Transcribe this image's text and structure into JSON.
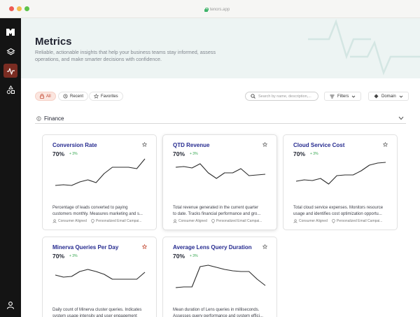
{
  "browser": {
    "url": "tenors.app"
  },
  "header": {
    "title": "Metrics",
    "subtitle_line1": "Reliable, actionable insights that help your business teams stay informed, assess",
    "subtitle_line2": "operations, and make smarter decisions with confidence."
  },
  "filters": {
    "all_label": "All",
    "recent_label": "Recent",
    "favorites_label": "Favorites",
    "search_placeholder": "Search by name, description,...",
    "filters_label": "Filters",
    "domain_label": "Domain"
  },
  "section": {
    "title": "Finance"
  },
  "colors": {
    "accent": "#c2462f",
    "title_blue": "#252a8f",
    "positive": "#2fa34a",
    "sidebar_active": "#7a2c22"
  },
  "cards": [
    {
      "title": "Conversion Rate",
      "value": "70%",
      "delta": "+ 3%",
      "starred": false,
      "desc_line1": "Percentage of leads converted to paying",
      "desc_line2": "customers monthly. Measures marketing and s...",
      "tag1": "Consumer Aligned",
      "tag2": "Personalized Email Campai...",
      "trend": [
        2,
        3,
        2,
        7,
        10,
        6,
        19,
        28,
        28,
        28,
        26,
        40
      ]
    },
    {
      "title": "QTD Revenue",
      "value": "70%",
      "delta": "+ 3%",
      "starred": false,
      "desc_line1": "Total revenue generated in the current quarter",
      "desc_line2": "to date. Tracks financial performance and gro...",
      "tag1": "Consumer Aligned",
      "tag2": "Personalized Email Campai...",
      "trend": [
        28,
        29,
        27,
        33,
        20,
        12,
        20,
        20,
        26,
        16,
        17,
        18
      ]
    },
    {
      "title": "Cloud Service Cost",
      "value": "70%",
      "delta": "+ 3%",
      "starred": false,
      "desc_line1": "Total cloud service expenses. Monitors resource",
      "desc_line2": "usage and identifies cost optimization opportu...",
      "tag1": "Consumer Aligned",
      "tag2": "Personalized Email Campai...",
      "trend": [
        8,
        10,
        9,
        12,
        4,
        16,
        17,
        17,
        23,
        31,
        34,
        35
      ]
    },
    {
      "title": "Minerva Queries Per Day",
      "value": "70%",
      "delta": "+ 3%",
      "starred": true,
      "desc_line1": "Daily count of Minerva cluster queries. Indicates",
      "desc_line2": "system usage intensity and user engagement",
      "trend": [
        20,
        17,
        18,
        25,
        28,
        25,
        21,
        14,
        14,
        14,
        14,
        24
      ]
    },
    {
      "title": "Average Lens Query Duration",
      "value": "70%",
      "delta": "+ 3%",
      "starred": false,
      "desc_line1": "Mean duration of Lens queries in milliseconds.",
      "desc_line2": "Assesses query performance and system effici...",
      "trend": [
        2,
        3,
        3,
        32,
        34,
        31,
        28,
        26,
        25,
        25,
        14,
        5
      ]
    }
  ]
}
